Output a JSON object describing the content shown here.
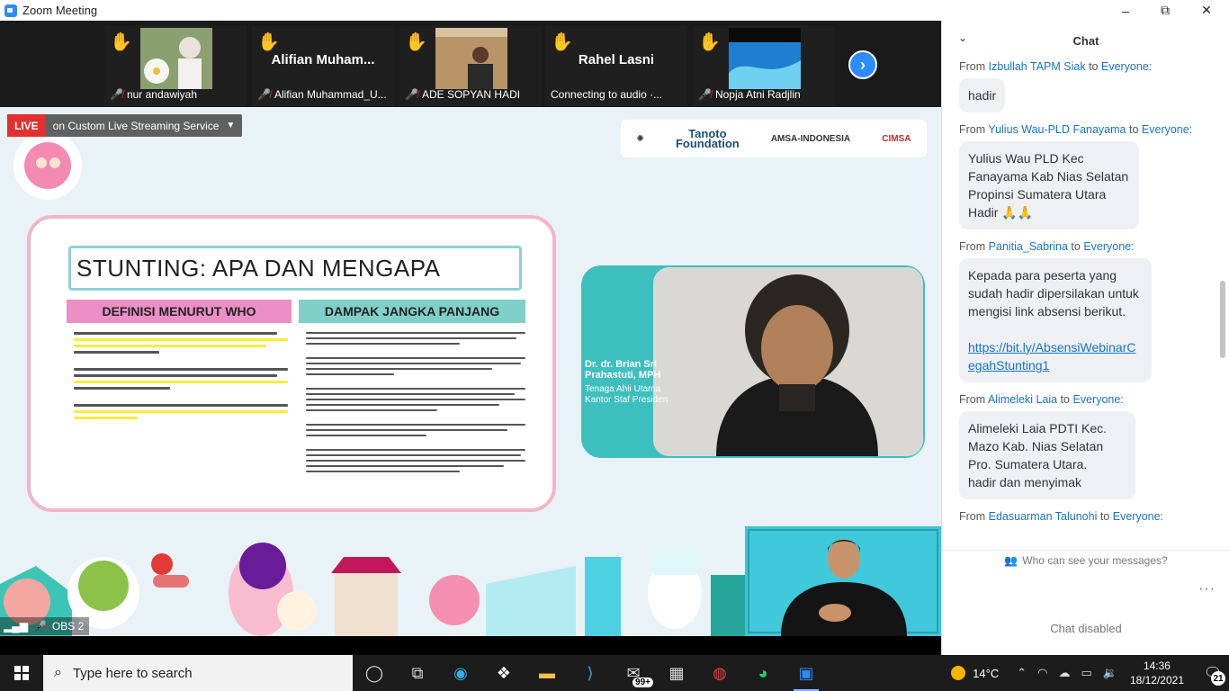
{
  "window": {
    "title": "Zoom Meeting",
    "minimize": "–",
    "restore": "⧉",
    "close": "✕"
  },
  "participants": [
    {
      "name": "nur andawiyah",
      "big_name": "",
      "has_video": true
    },
    {
      "name": "Alifian Muhammad_U...",
      "big_name": "Alifian  Muham...",
      "has_video": false
    },
    {
      "name": "ADE SOPYAN HADI",
      "big_name": "",
      "has_video": true
    },
    {
      "name": "Connecting to audio ·...",
      "big_name": "Rahel Lasni",
      "has_video": false
    },
    {
      "name": "Nopja Atni Radjlin",
      "big_name": "",
      "has_video": true
    }
  ],
  "live": {
    "badge": "LIVE",
    "text": "on Custom Live Streaming Service"
  },
  "sponsors": {
    "tanoto": "Tanoto\nFoundation",
    "amsa": "AMSA-INDONESIA",
    "cimsa": "CIMSA"
  },
  "slide": {
    "title": "STUNTING: APA DAN MENGAPA",
    "left_header": "DEFINISI MENURUT WHO",
    "right_header": "DAMPAK JANGKA PANJANG"
  },
  "speaker": {
    "name": "Dr. dr. Brian Sri Prahastuti, MPH",
    "role": "Tenaga Ahli Utama Kantor Staf Presiden"
  },
  "sign_bar": {
    "text": "OBS 2"
  },
  "chat": {
    "title": "Chat",
    "messages": [
      {
        "from": "Izbullah TAPM Siak",
        "to": "Everyone:",
        "text": "hadir",
        "link": ""
      },
      {
        "from": "Yulius Wau-PLD Fanayama",
        "to": "Everyone:",
        "text": "Yulius Wau PLD Kec Fanayama Kab Nias Selatan Propinsi Sumatera Utara Hadir 🙏🙏",
        "link": ""
      },
      {
        "from": "Panitia_Sabrina",
        "to": "Everyone:",
        "text": "Kepada para peserta yang sudah hadir dipersilakan untuk mengisi link absensi berikut.",
        "link": "https://bit.ly/AbsensiWebinarCegahStunting1"
      },
      {
        "from": "Alimeleki Laia",
        "to": "Everyone:",
        "text": "Alimeleki Laia PDTI Kec. Mazo Kab. Nias Selatan Pro. Sumatera Utara.\nhadir dan menyimak",
        "link": ""
      },
      {
        "from": "Edasuarman Talunohi",
        "to": "Everyone:",
        "text": "",
        "link": ""
      }
    ],
    "from_prefix": "From",
    "to_word": "to",
    "who_can_see": "Who can see your messages?",
    "more": "···",
    "disabled": "Chat disabled"
  },
  "taskbar": {
    "search_placeholder": "Type here to search",
    "mail_badge": "99+",
    "temperature": "14°C",
    "time": "14:36",
    "date": "18/12/2021",
    "notifications": "21"
  }
}
